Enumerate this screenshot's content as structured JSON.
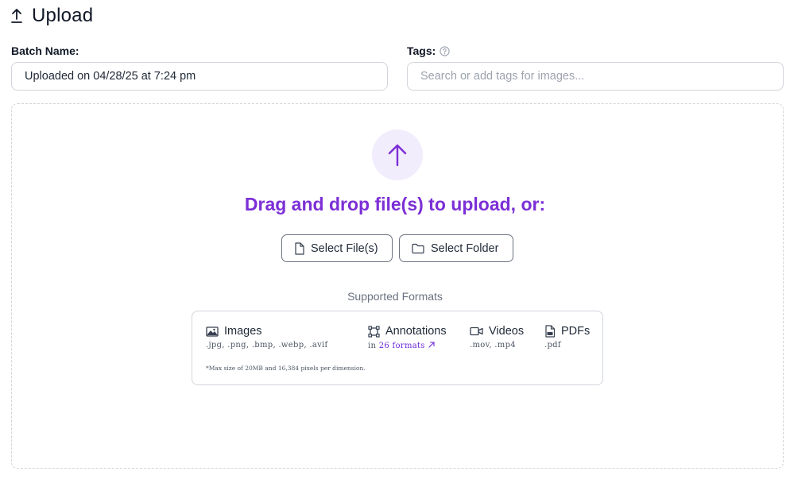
{
  "header": {
    "title": "Upload",
    "icon": "upload-icon"
  },
  "batch": {
    "label": "Batch Name:",
    "value": "Uploaded on 04/28/25 at 7:24 pm"
  },
  "tags": {
    "label": "Tags:",
    "help_icon": "help-circle-icon",
    "placeholder": "Search or add tags for images..."
  },
  "dropzone": {
    "icon": "arrow-up-icon",
    "drag_text": "Drag and drop file(s) to upload, or:",
    "select_files_label": "Select File(s)",
    "select_folder_label": "Select Folder"
  },
  "formats": {
    "title": "Supported Formats",
    "images": {
      "label": "Images",
      "exts": ".jpg, .png, .bmp, .webp, .avif"
    },
    "annotations": {
      "label": "Annotations",
      "prefix": "in",
      "link": "26 formats"
    },
    "videos": {
      "label": "Videos",
      "exts": ".mov, .mp4"
    },
    "pdfs": {
      "label": "PDFs",
      "exts": ".pdf"
    },
    "max_note": "*Max size of 20MB and 16,384 pixels per dimension."
  },
  "colors": {
    "accent": "#7c2fd6",
    "accent_bg": "#f1edfd",
    "border": "#d1d5db"
  }
}
